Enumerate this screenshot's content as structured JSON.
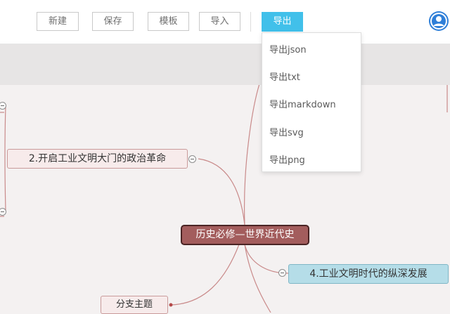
{
  "toolbar": {
    "new_label": "新建",
    "save_label": "保存",
    "template_label": "模板",
    "import_label": "导入",
    "export_label": "导出"
  },
  "export_menu": {
    "items": [
      "导出json",
      "导出txt",
      "导出markdown",
      "导出svg",
      "导出png"
    ]
  },
  "mindmap": {
    "root": "历史必修—世界近代史",
    "node_2": "2.开启工业文明大门的政治革命",
    "node_4": "4.工业文明时代的纵深发展",
    "branch": "分支主题"
  },
  "colors": {
    "accent": "#41c0ea",
    "root_fill": "#a35d5d",
    "node_pink": "#f7ebeb",
    "node_blue": "#b5dde8",
    "connector": "#c98a8a"
  }
}
